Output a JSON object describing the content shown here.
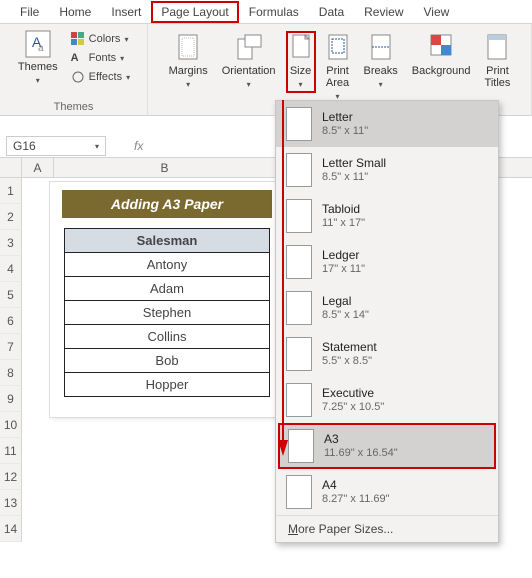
{
  "tabs": [
    "File",
    "Home",
    "Insert",
    "Page Layout",
    "Formulas",
    "Data",
    "Review",
    "View"
  ],
  "active_tab": "Page Layout",
  "themes": {
    "group_label": "Themes",
    "themes_btn": "Themes",
    "colors": "Colors",
    "fonts": "Fonts",
    "effects": "Effects"
  },
  "page_setup": {
    "margins": "Margins",
    "orientation": "Orientation",
    "size": "Size",
    "print_area": "Print\nArea",
    "breaks": "Breaks",
    "background": "Background",
    "print_titles": "Print\nTitles"
  },
  "namebox": "G16",
  "columns": {
    "A_width": 32,
    "B_width": 222
  },
  "title": "Adding A3 Paper",
  "table": {
    "header": "Salesman",
    "rows": [
      "Antony",
      "Adam",
      "Stephen",
      "Collins",
      "Bob",
      "Hopper"
    ]
  },
  "sizes": [
    {
      "name": "Letter",
      "dim": "8.5\" x 11\"",
      "selected": true
    },
    {
      "name": "Letter Small",
      "dim": "8.5\" x 11\""
    },
    {
      "name": "Tabloid",
      "dim": "11\" x 17\""
    },
    {
      "name": "Ledger",
      "dim": "17\" x 11\""
    },
    {
      "name": "Legal",
      "dim": "8.5\" x 14\""
    },
    {
      "name": "Statement",
      "dim": "5.5\" x 8.5\""
    },
    {
      "name": "Executive",
      "dim": "7.25\" x 10.5\""
    },
    {
      "name": "A3",
      "dim": "11.69\" x 16.54\"",
      "highlight": true
    },
    {
      "name": "A4",
      "dim": "8.27\" x 11.69\""
    }
  ],
  "more_sizes": "More Paper Sizes..."
}
